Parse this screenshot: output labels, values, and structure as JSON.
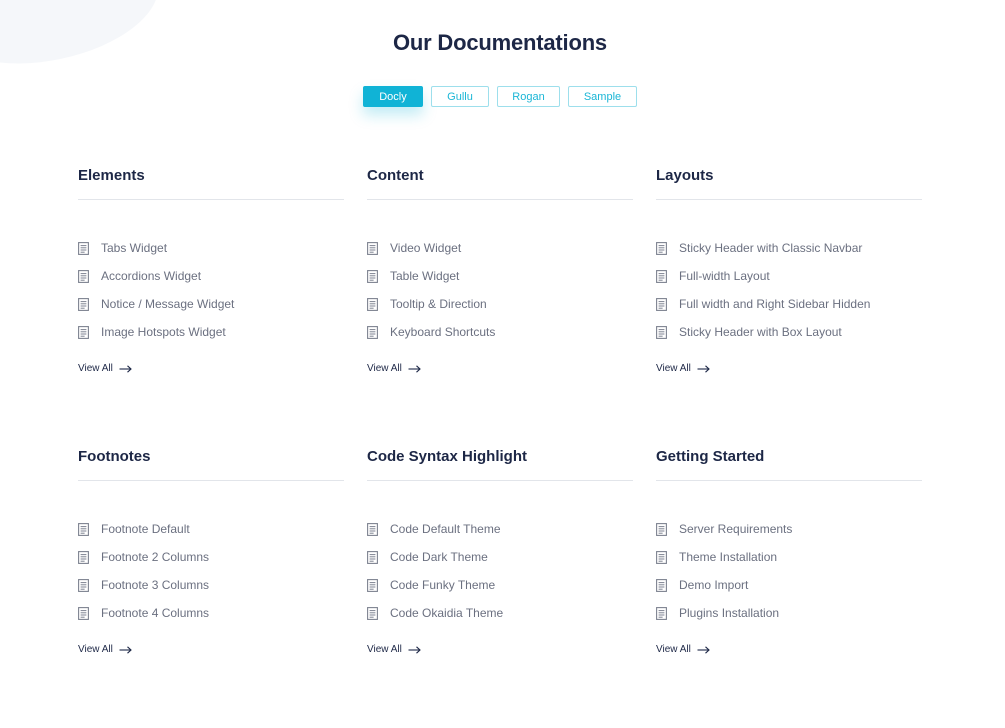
{
  "page": {
    "title": "Our Documentations"
  },
  "tabs": [
    {
      "label": "Docly",
      "active": true
    },
    {
      "label": "Gullu",
      "active": false
    },
    {
      "label": "Rogan",
      "active": false
    },
    {
      "label": "Sample",
      "active": false
    }
  ],
  "icons": {
    "item": "document-icon",
    "view_all": "arrow-right-icon"
  },
  "colors": {
    "accent": "#10b3d6",
    "heading": "#1d2746",
    "text": "#6b7080"
  },
  "sections": [
    {
      "title": "Elements",
      "items": [
        "Tabs Widget",
        "Accordions Widget",
        "Notice / Message Widget",
        "Image Hotspots Widget"
      ],
      "view_all": "View All"
    },
    {
      "title": "Content",
      "items": [
        "Video Widget",
        "Table Widget",
        "Tooltip & Direction",
        "Keyboard Shortcuts"
      ],
      "view_all": "View All"
    },
    {
      "title": "Layouts",
      "items": [
        "Sticky Header with Classic Navbar",
        "Full-width Layout",
        "Full width and Right Sidebar Hidden",
        "Sticky Header with Box Layout"
      ],
      "view_all": "View All"
    },
    {
      "title": "Footnotes",
      "items": [
        "Footnote Default",
        "Footnote 2 Columns",
        "Footnote 3 Columns",
        "Footnote 4 Columns"
      ],
      "view_all": "View All"
    },
    {
      "title": "Code Syntax Highlight",
      "items": [
        "Code Default Theme",
        "Code Dark Theme",
        "Code Funky Theme",
        "Code Okaidia Theme"
      ],
      "view_all": "View All"
    },
    {
      "title": "Getting Started",
      "items": [
        "Server Requirements",
        "Theme Installation",
        "Demo Import",
        "Plugins Installation"
      ],
      "view_all": "View All"
    }
  ]
}
